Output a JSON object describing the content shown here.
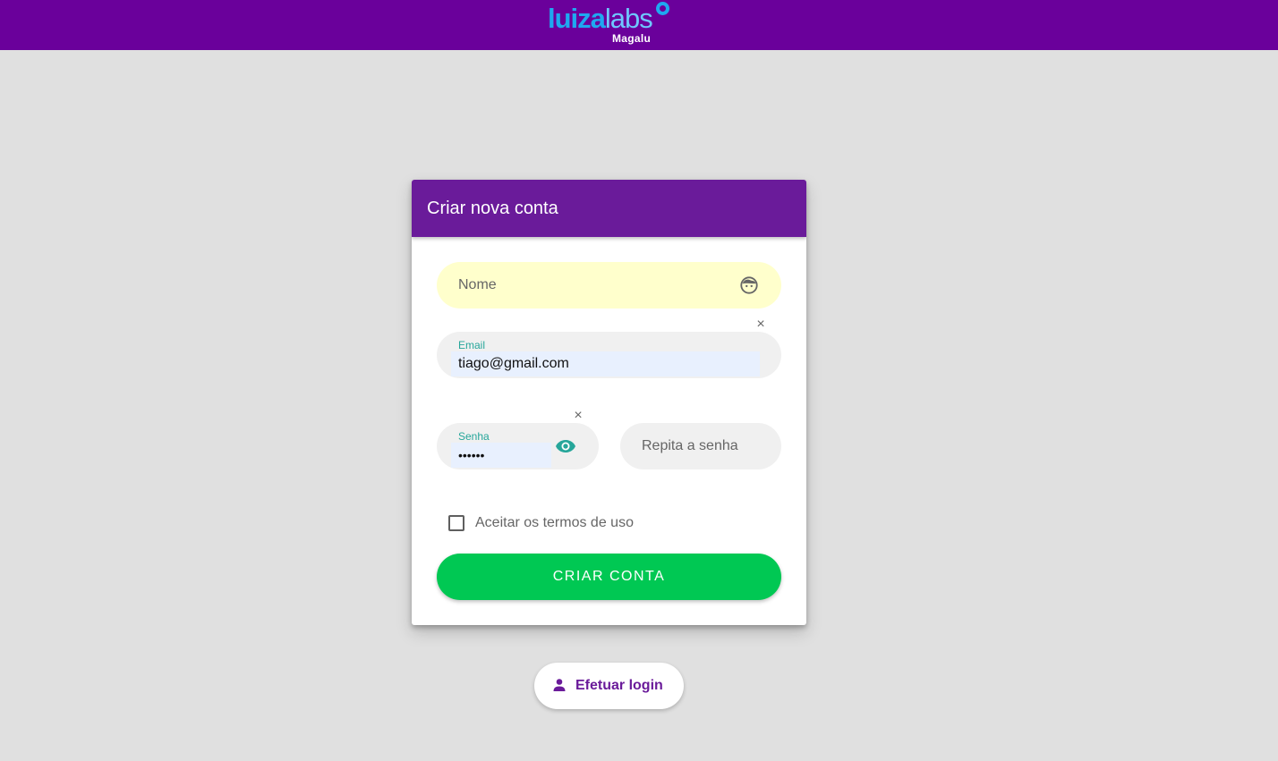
{
  "header": {
    "logo": {
      "part1": "luiza",
      "part2": "labs",
      "sub": "Magalu"
    },
    "colors": {
      "bar": "#6a009b",
      "logo": "#1fa8f0"
    }
  },
  "form": {
    "title": "Criar nova conta",
    "fields": {
      "nome": {
        "placeholder": "Nome",
        "icon": "face-icon"
      },
      "email": {
        "label": "Email",
        "value": "tiago@gmail.com",
        "clear": "×"
      },
      "senha": {
        "label": "Senha",
        "value": "••••••",
        "clear": "×",
        "icon": "eye-icon"
      },
      "repita": {
        "placeholder": "Repita a senha"
      }
    },
    "terms": {
      "label": "Aceitar os termos de uso",
      "checked": false
    },
    "submit_label": "CRIAR CONTA"
  },
  "login": {
    "label": "Efetuar login",
    "icon": "person-icon"
  },
  "colors": {
    "accent": "#6a1b9a",
    "submit": "#00c853",
    "focus": "#26a69a",
    "nome_bg": "#ffffcc"
  }
}
